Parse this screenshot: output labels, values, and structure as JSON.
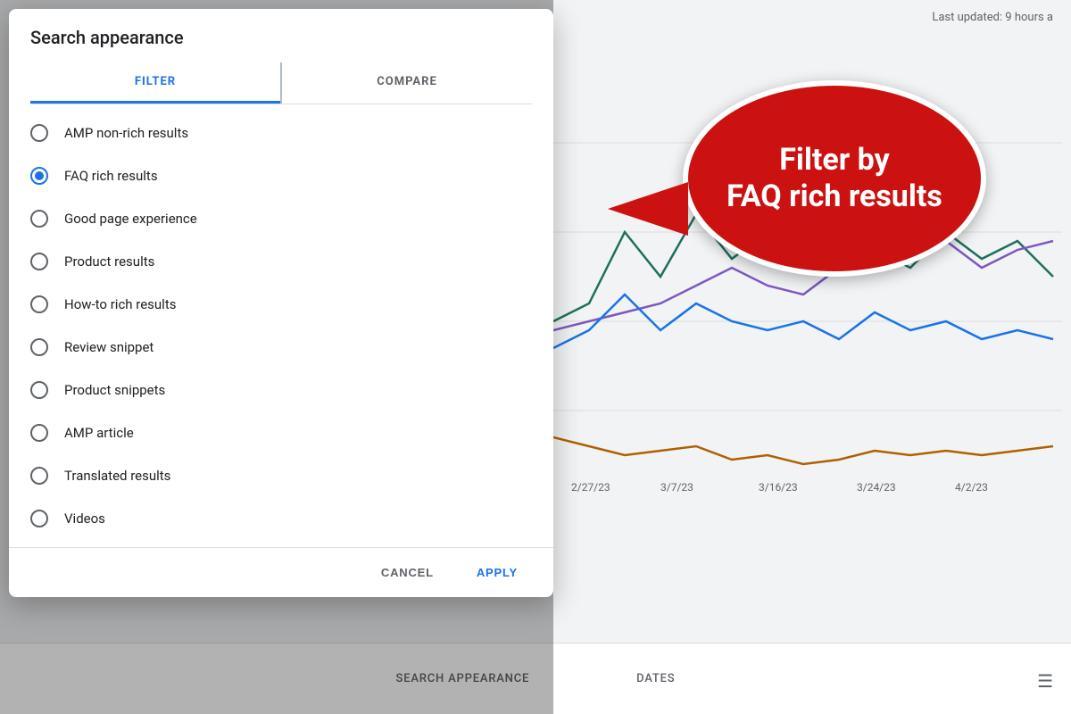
{
  "header": {
    "last_updated": "Last updated: 9 hours a"
  },
  "dialog": {
    "title": "Search appearance",
    "tabs": [
      {
        "id": "filter",
        "label": "FILTER",
        "active": true
      },
      {
        "id": "compare",
        "label": "COMPARE",
        "active": false
      }
    ],
    "options": [
      {
        "id": "amp-non-rich",
        "label": "AMP non-rich results",
        "selected": false
      },
      {
        "id": "faq-rich",
        "label": "FAQ rich results",
        "selected": true
      },
      {
        "id": "good-page",
        "label": "Good page experience",
        "selected": false
      },
      {
        "id": "product-results",
        "label": "Product results",
        "selected": false
      },
      {
        "id": "how-to-rich",
        "label": "How-to rich results",
        "selected": false
      },
      {
        "id": "review-snippet",
        "label": "Review snippet",
        "selected": false
      },
      {
        "id": "product-snippets",
        "label": "Product snippets",
        "selected": false
      },
      {
        "id": "amp-article",
        "label": "AMP article",
        "selected": false
      },
      {
        "id": "translated-results",
        "label": "Translated results",
        "selected": false
      },
      {
        "id": "videos",
        "label": "Videos",
        "selected": false
      }
    ],
    "footer": {
      "cancel_label": "CANCEL",
      "apply_label": "APPLY"
    }
  },
  "callout": {
    "text": "Filter by\nFAQ rich results"
  },
  "bottom_bar": {
    "search_appearance_label": "SEARCH APPEARANCE",
    "dates_label": "DATES"
  },
  "chart": {
    "dates": [
      "2/27/23",
      "3/7/23",
      "3/16/23",
      "3/24/23",
      "4/2/23"
    ]
  }
}
